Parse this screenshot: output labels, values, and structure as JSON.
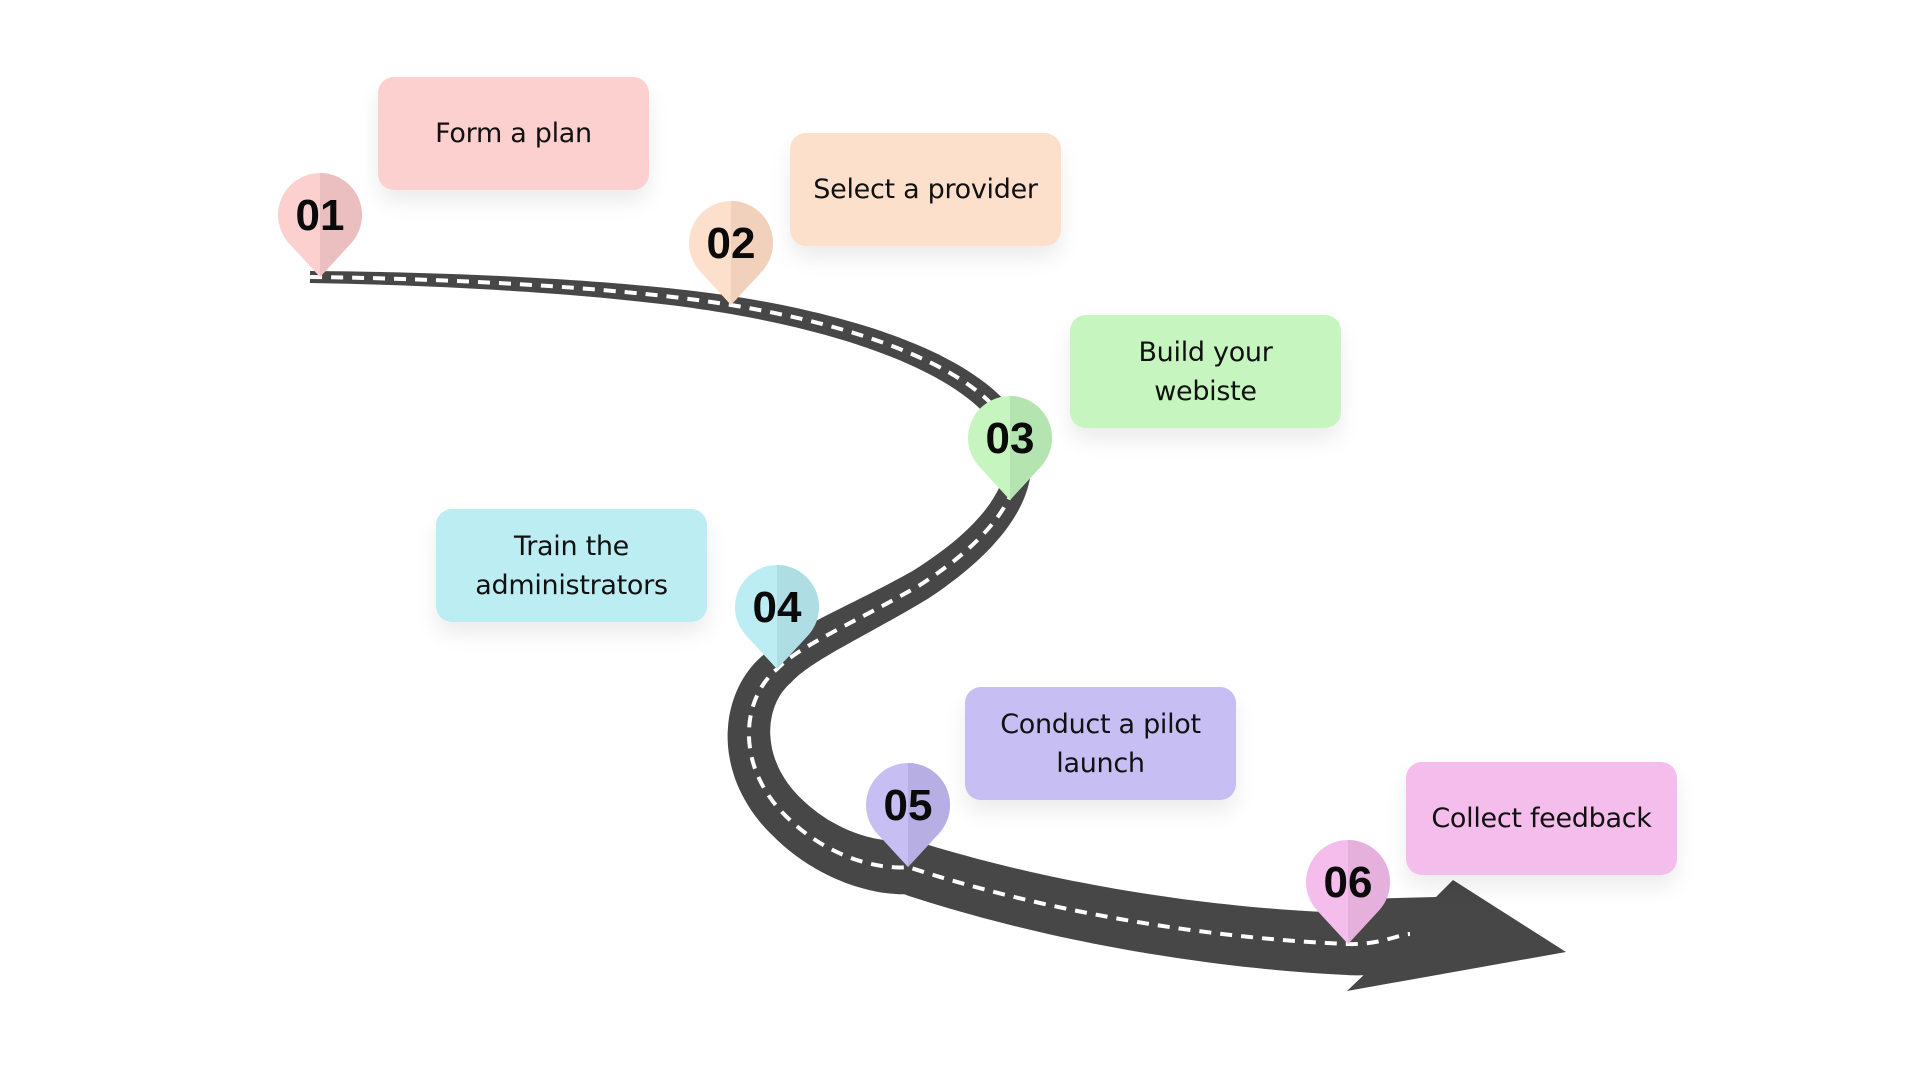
{
  "diagram": {
    "type": "roadmap",
    "road_color": "#474747",
    "lane_marking_color": "#ffffff",
    "steps": [
      {
        "number": "01",
        "label": "Form a plan",
        "color": "#fdd0d0",
        "pin_shade": "#ebbfc0"
      },
      {
        "number": "02",
        "label": "Select a provider",
        "color": "#fde0cc",
        "pin_shade": "#f1d0bc"
      },
      {
        "number": "03",
        "label": "Build your webiste",
        "color": "#c6f5c0",
        "pin_shade": "#b4e5b0"
      },
      {
        "number": "04",
        "label": "Train the administrators",
        "color": "#bcedf3",
        "pin_shade": "#aedde3"
      },
      {
        "number": "05",
        "label": "Conduct a pilot launch",
        "color": "#c7bff3",
        "pin_shade": "#b7afe3"
      },
      {
        "number": "06",
        "label": "Collect feedback",
        "color": "#f5bdec",
        "pin_shade": "#e5b0dc"
      }
    ]
  }
}
